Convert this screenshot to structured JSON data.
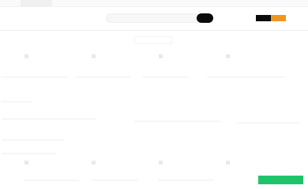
{
  "header": {
    "search_placeholder": "",
    "search_button_label": "",
    "logo_colors": [
      "#0b0b0b",
      "#f0961f"
    ]
  },
  "sub_bar": {
    "chip_label": ""
  },
  "cta": {
    "label": "",
    "color": "#1fc46a"
  },
  "theme": {
    "background": "#ffffff",
    "search_button_color": "#0b0b0b"
  }
}
